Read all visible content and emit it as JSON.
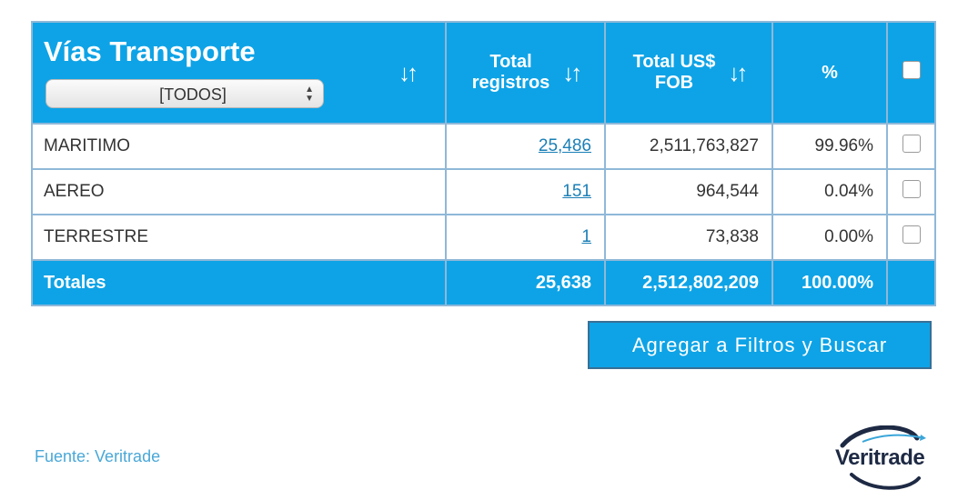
{
  "table": {
    "headers": {
      "vias_title": "Vías Transporte",
      "total_registros": [
        "Total",
        "registros"
      ],
      "total_fob": [
        "Total US$",
        "FOB"
      ],
      "percent": "%"
    },
    "sort_icon": "sort-arrows-icon",
    "filter_select": {
      "value": "[TODOS]"
    },
    "rows": [
      {
        "name": "MARITIMO",
        "registros": "25,486",
        "fob": "2,511,763,827",
        "percent": "99.96%"
      },
      {
        "name": "AEREO",
        "registros": "151",
        "fob": "964,544",
        "percent": "0.04%"
      },
      {
        "name": "TERRESTRE",
        "registros": "1",
        "fob": "73,838",
        "percent": "0.00%"
      }
    ],
    "totals": {
      "label": "Totales",
      "registros": "25,638",
      "fob": "2,512,802,209",
      "percent": "100.00%"
    }
  },
  "button": {
    "label": "Agregar a Filtros y Buscar"
  },
  "footer": {
    "source": "Fuente: Veritrade",
    "logo": "Veritrade"
  },
  "colors": {
    "accent": "#0ea3e6",
    "link": "#1a7fb6",
    "source_text": "#4aa8d8"
  }
}
